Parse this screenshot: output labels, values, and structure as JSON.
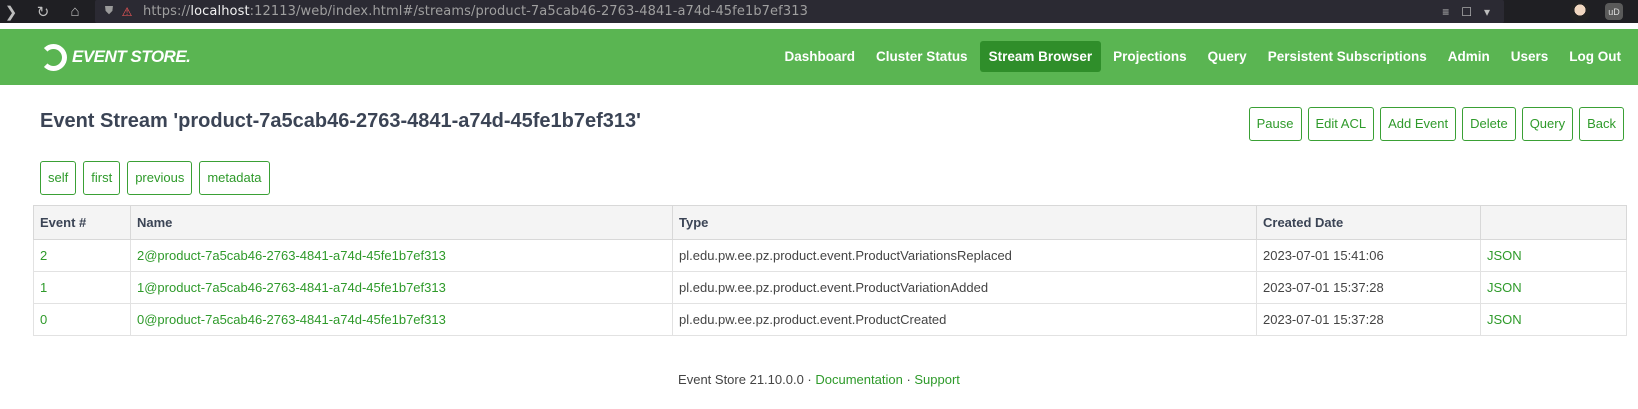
{
  "browser": {
    "url_prefix": "https://",
    "url_host": "localhost",
    "url_rest": ":12113/web/index.html#/streams/product-7a5cab46-2763-4841-a74d-45fe1b7ef313",
    "extension_label": "uD"
  },
  "app": {
    "logo_text": "EVENT STORE.",
    "nav": [
      "Dashboard",
      "Cluster Status",
      "Stream Browser",
      "Projections",
      "Query",
      "Persistent Subscriptions",
      "Admin",
      "Users",
      "Log Out"
    ],
    "active_nav": "Stream Browser"
  },
  "page": {
    "title": "Event Stream 'product-7a5cab46-2763-4841-a74d-45fe1b7ef313'",
    "actions": [
      "Pause",
      "Edit ACL",
      "Add Event",
      "Delete",
      "Query",
      "Back"
    ],
    "pager": [
      "self",
      "first",
      "previous",
      "metadata"
    ]
  },
  "table": {
    "headers": [
      "Event #",
      "Name",
      "Type",
      "Created Date",
      ""
    ],
    "rows": [
      {
        "number": "2",
        "name": "2@product-7a5cab46-2763-4841-a74d-45fe1b7ef313",
        "type": "pl.edu.pw.ee.pz.product.event.ProductVariationsReplaced",
        "created": "2023-07-01 15:41:06",
        "link": "JSON"
      },
      {
        "number": "1",
        "name": "1@product-7a5cab46-2763-4841-a74d-45fe1b7ef313",
        "type": "pl.edu.pw.ee.pz.product.event.ProductVariationAdded",
        "created": "2023-07-01 15:37:28",
        "link": "JSON"
      },
      {
        "number": "0",
        "name": "0@product-7a5cab46-2763-4841-a74d-45fe1b7ef313",
        "type": "pl.edu.pw.ee.pz.product.event.ProductCreated",
        "created": "2023-07-01 15:37:28",
        "link": "JSON"
      }
    ]
  },
  "footer": {
    "version": "Event Store 21.10.0.0",
    "sep": " · ",
    "documentation": "Documentation",
    "support": "Support"
  },
  "colors": {
    "header_green": "#5ab552",
    "active_green": "#2f8e2a",
    "link_green": "#2e9a2a"
  }
}
